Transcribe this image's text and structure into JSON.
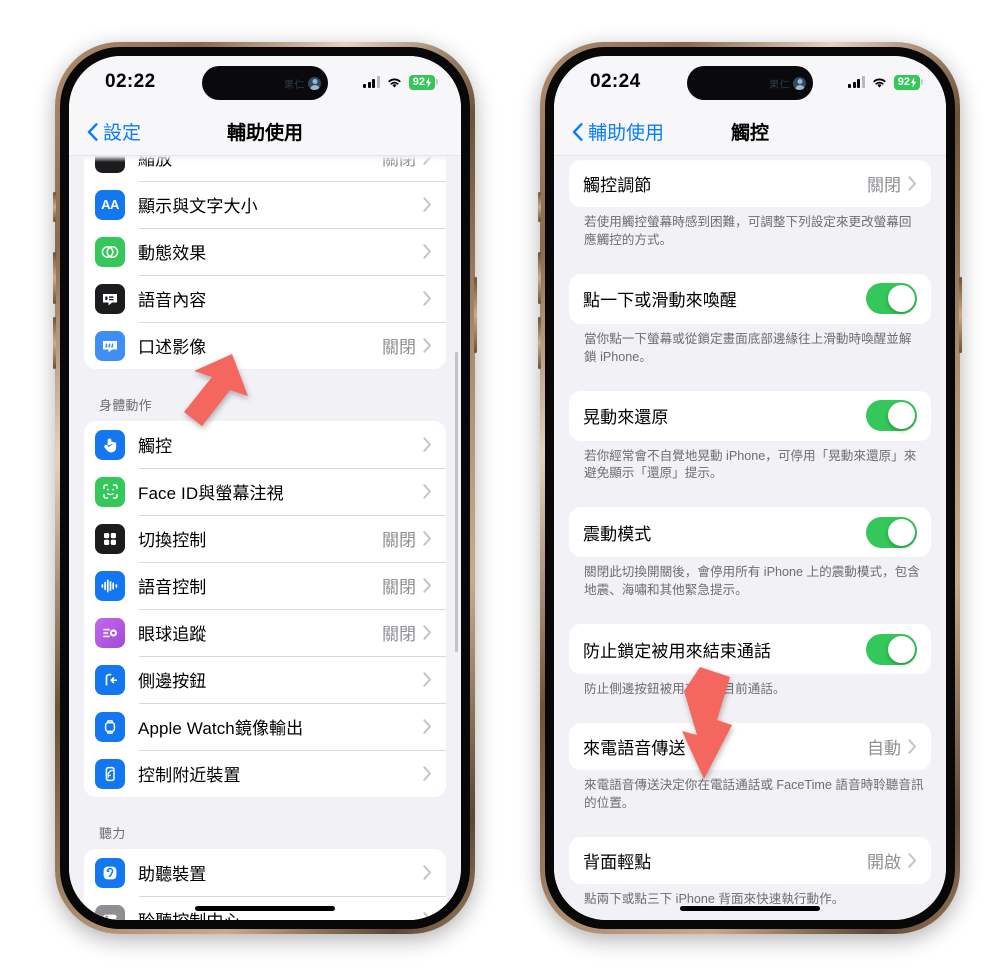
{
  "colors": {
    "accent_blue": "#0a7cff",
    "toggle_green": "#34c759",
    "arrow_red": "#f4675f",
    "battery_green": "#34c759",
    "value_gray": "#8e8e93"
  },
  "left_phone": {
    "status": {
      "time": "02:22",
      "island_name": "果仁",
      "battery": "92",
      "battery_charging": true
    },
    "nav": {
      "back_label": "設定",
      "title": "輔助使用"
    },
    "groups": [
      {
        "id": "vision-group",
        "rows": [
          {
            "label": "顯示與文字大小",
            "value": "",
            "icon": "aa-text-icon",
            "icon_color": "#1277f0",
            "chevron": true
          },
          {
            "label": "動態效果",
            "value": "",
            "icon": "motion-icon",
            "icon_color": "#34c759",
            "chevron": true
          },
          {
            "label": "語音內容",
            "value": "",
            "icon": "spoken-content-icon",
            "icon_color": "#1c1c1e",
            "chevron": true
          },
          {
            "label": "口述影像",
            "value": "關閉",
            "icon": "audio-description-icon",
            "icon_color": "#3d8ef5",
            "chevron": true
          }
        ]
      }
    ],
    "physical_header": "身體動作",
    "physical_rows": [
      {
        "label": "觸控",
        "value": "",
        "icon": "touch-icon",
        "icon_color": "#1277f0",
        "chevron": true
      },
      {
        "label": "Face ID與螢幕注視",
        "value": "",
        "icon": "face-id-icon",
        "icon_color": "#34c759",
        "chevron": true
      },
      {
        "label": "切換控制",
        "value": "關閉",
        "icon": "switch-control-icon",
        "icon_color": "#1c1c1e",
        "chevron": true
      },
      {
        "label": "語音控制",
        "value": "關閉",
        "icon": "voice-control-icon",
        "icon_color": "#1277f0",
        "chevron": true
      },
      {
        "label": "眼球追蹤",
        "value": "關閉",
        "icon": "eye-tracking-icon",
        "icon_color": "#b45ae0",
        "chevron": true
      },
      {
        "label": "側邊按鈕",
        "value": "",
        "icon": "side-button-icon",
        "icon_color": "#1277f0",
        "chevron": true
      },
      {
        "label": "Apple Watch鏡像輸出",
        "value": "",
        "icon": "apple-watch-icon",
        "icon_color": "#1277f0",
        "chevron": true
      },
      {
        "label": "控制附近裝置",
        "value": "",
        "icon": "nearby-devices-icon",
        "icon_color": "#1277f0",
        "chevron": true
      }
    ],
    "hearing_header": "聽力",
    "hearing_rows": [
      {
        "label": "助聽裝置",
        "value": "",
        "icon": "hearing-aid-icon",
        "icon_color": "#1277f0",
        "chevron": true
      },
      {
        "label": "聆聽控制中心",
        "value": "",
        "icon": "listening-control-icon",
        "icon_color": "#8e8e93",
        "chevron": true
      }
    ]
  },
  "right_phone": {
    "status": {
      "time": "02:24",
      "island_name": "果仁",
      "battery": "92",
      "battery_charging": true
    },
    "nav": {
      "back_label": "輔助使用",
      "title": "觸控"
    },
    "items": [
      {
        "kind": "link",
        "label": "觸控調節",
        "value": "關閉",
        "footnote": "若使用觸控螢幕時感到困難，可調整下列設定來更改螢幕回應觸控的方式。"
      },
      {
        "kind": "toggle",
        "label": "點一下或滑動來喚醒",
        "on": true,
        "footnote": "當你點一下螢幕或從鎖定畫面底部邊緣往上滑動時喚醒並解鎖 iPhone。"
      },
      {
        "kind": "toggle",
        "label": "晃動來還原",
        "on": true,
        "footnote": "若你經常會不自覺地晃動 iPhone，可停用「晃動來還原」來避免顯示「還原」提示。"
      },
      {
        "kind": "toggle",
        "label": "震動模式",
        "on": true,
        "footnote": "關閉此切換開關後，會停用所有 iPhone 上的震動模式，包含地震、海嘯和其他緊急提示。"
      },
      {
        "kind": "toggle",
        "label": "防止鎖定被用來結束通話",
        "on": true,
        "footnote": "防止側邊按鈕被用來結束目前通話。"
      },
      {
        "kind": "link",
        "label": "來電語音傳送",
        "value": "自動",
        "footnote": "來電語音傳送決定你在電話通話或 FaceTime 語音時聆聽音訊的位置。"
      },
      {
        "kind": "link",
        "label": "背面輕點",
        "value": "開啟",
        "footnote": "點兩下或點三下 iPhone 背面來快速執行動作。"
      }
    ]
  },
  "annotations": [
    {
      "name": "arrow-to-touch",
      "target": "觸控"
    },
    {
      "name": "arrow-to-back-tap",
      "target": "背面輕點"
    }
  ]
}
